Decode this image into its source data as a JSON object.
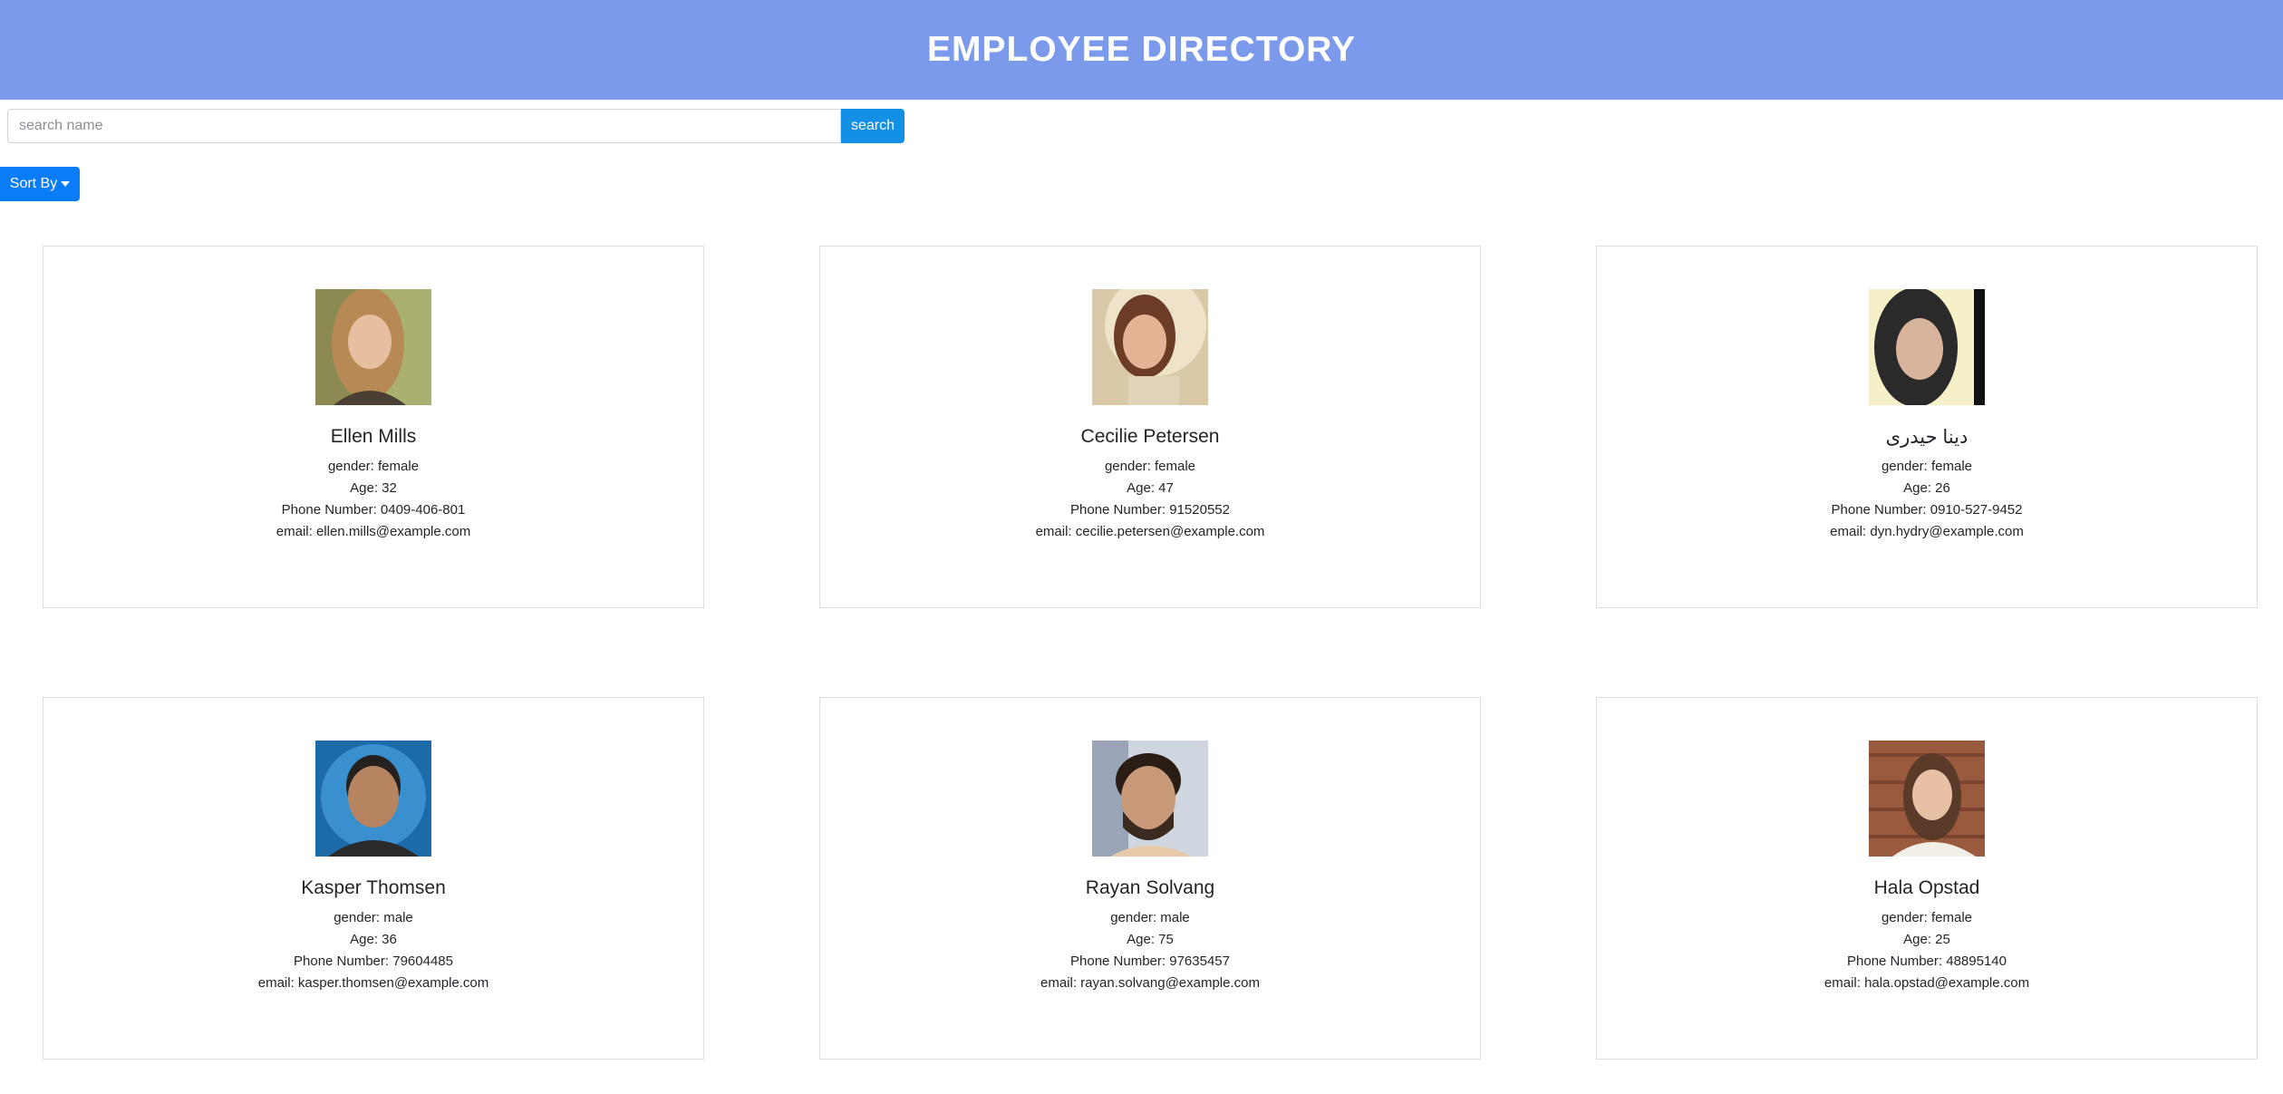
{
  "header": {
    "title": "EMPLOYEE DIRECTORY"
  },
  "search": {
    "placeholder": "search name",
    "value": "",
    "button_label": "search"
  },
  "sort": {
    "label": "Sort By"
  },
  "labels": {
    "gender": "gender: ",
    "age": "Age: ",
    "phone": "Phone Number: ",
    "email": "email: "
  },
  "employees": [
    {
      "name": "Ellen Mills",
      "gender": "female",
      "age": "32",
      "phone": "0409-406-801",
      "email": "ellen.mills@example.com"
    },
    {
      "name": "Cecilie Petersen",
      "gender": "female",
      "age": "47",
      "phone": "91520552",
      "email": "cecilie.petersen@example.com"
    },
    {
      "name": "دينا حيدری",
      "gender": "female",
      "age": "26",
      "phone": "0910-527-9452",
      "email": "dyn.hydry@example.com"
    },
    {
      "name": "Kasper Thomsen",
      "gender": "male",
      "age": "36",
      "phone": "79604485",
      "email": "kasper.thomsen@example.com"
    },
    {
      "name": "Rayan Solvang",
      "gender": "male",
      "age": "75",
      "phone": "97635457",
      "email": "rayan.solvang@example.com"
    },
    {
      "name": "Hala Opstad",
      "gender": "female",
      "age": "25",
      "phone": "48895140",
      "email": "hala.opstad@example.com"
    }
  ]
}
